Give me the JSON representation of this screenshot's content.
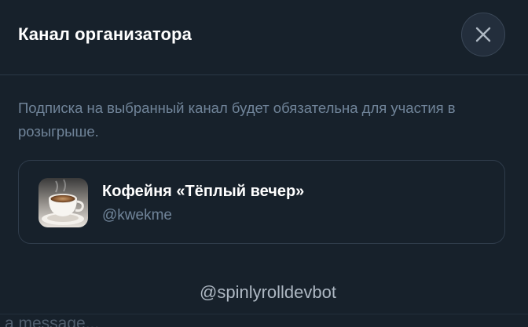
{
  "modal": {
    "title": "Канал организатора",
    "close_icon": "close-icon"
  },
  "description": "Подписка на выбранный канал будет обязательна для участия в розыгрыше.",
  "channel": {
    "name": "Кофейня «Тёплый вечер»",
    "handle": "@kwekme",
    "avatar_icon": "coffee-cup-avatar"
  },
  "bot": {
    "username": "@spinlyrolldevbot"
  },
  "message_input": {
    "placeholder_fragment": "a message..."
  },
  "colors": {
    "background": "#17212b",
    "title": "#ffffff",
    "muted_text": "#708499",
    "card_border": "#2f3c4b",
    "close_button_bg": "#232e3c"
  }
}
